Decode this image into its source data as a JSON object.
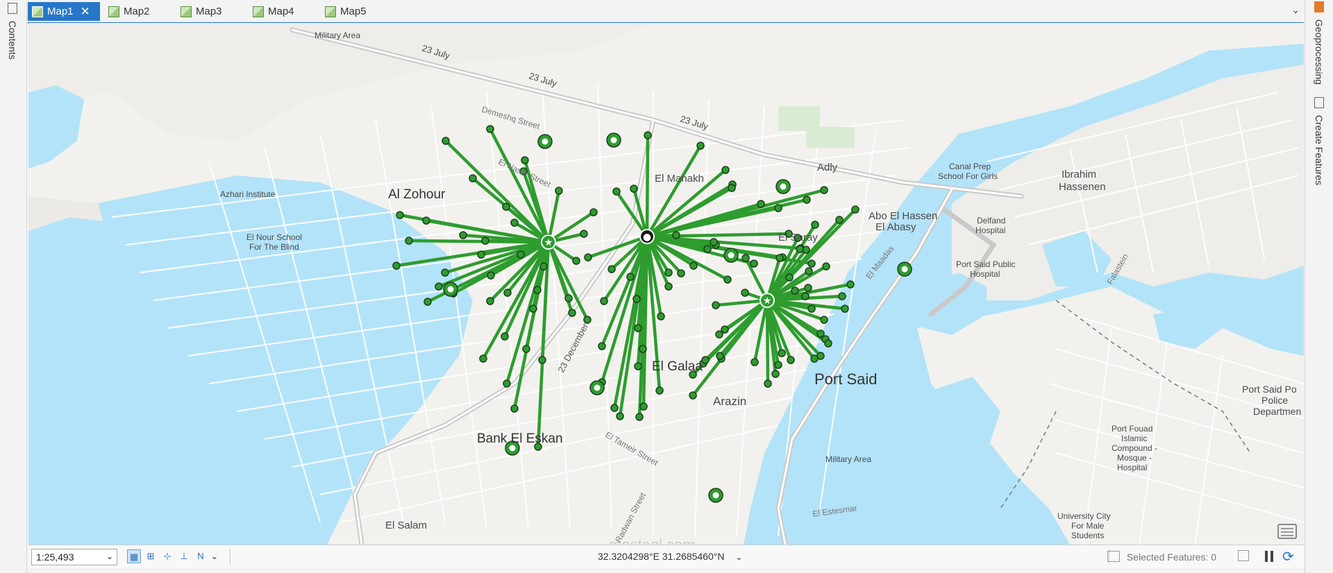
{
  "left_panel": {
    "contents_label": "Contents"
  },
  "right_panel": {
    "geoprocessing_label": "Geoprocessing",
    "create_features_label": "Create Features"
  },
  "tabs": [
    {
      "label": "Map1",
      "active": true
    },
    {
      "label": "Map2",
      "active": false
    },
    {
      "label": "Map3",
      "active": false
    },
    {
      "label": "Map4",
      "active": false
    },
    {
      "label": "Map5",
      "active": false
    }
  ],
  "map": {
    "labels": {
      "military_area_nw": "Military Area",
      "july_1": "23 July",
      "july_2": "23 July",
      "july_3": "23 July",
      "demeshq": "Demeshq Street",
      "el_naser": "El Naser Street",
      "el_manakh": "El Manakh",
      "adly": "Adly",
      "canal_prep": [
        "Canal Prep",
        "School For Girls"
      ],
      "ibrahim": [
        "Ibrahim",
        "Hassenen"
      ],
      "al_zohour": "Al Zohour",
      "azhari": "Azhari Institute",
      "el_nour": [
        "El Nour School",
        "For The Blind"
      ],
      "abo_el_hassen": [
        "Abo El Hassen",
        "El Abasy"
      ],
      "delfand": [
        "Delfand",
        "Hospital"
      ],
      "el_saray": "El Saray",
      "el_maadas": "El Maadas",
      "port_said_public": [
        "Port Said Public",
        "Hospital"
      ],
      "falastein": "Falastein",
      "december": "23 December",
      "el_galaa": "El Galaa",
      "port_said": "Port Said",
      "el_manakh_zone": "Arazin",
      "bank_el_eskan": "Bank El Eskan",
      "el_tameir": "El Tameir Street",
      "military_area_s": "Military Area",
      "el_estesmar": "El Estesmar",
      "radwan": "Radwan Street",
      "el_salam": "El Salam",
      "port_said_police": [
        "Port Said Po",
        "Police",
        "Departmen"
      ],
      "port_fouad": [
        "Port Fouad",
        "Islamic",
        "Compound -",
        "Mosque -",
        "Hospital"
      ],
      "university_city": [
        "University City",
        "For Male",
        "Students"
      ],
      "watermark": "mostaql.com"
    },
    "colors": {
      "water": "#b3e3f8",
      "land": "#f2f1ee",
      "road": "#ffffff",
      "major_road": "#c8c8c8",
      "spider": "#2e9c2e",
      "point": "#2e9c2e"
    }
  },
  "statusbar": {
    "scale": "1:25,493",
    "coordinates": "32.3204298°E 31.2685460°N",
    "selected_features": "Selected Features: 0"
  }
}
